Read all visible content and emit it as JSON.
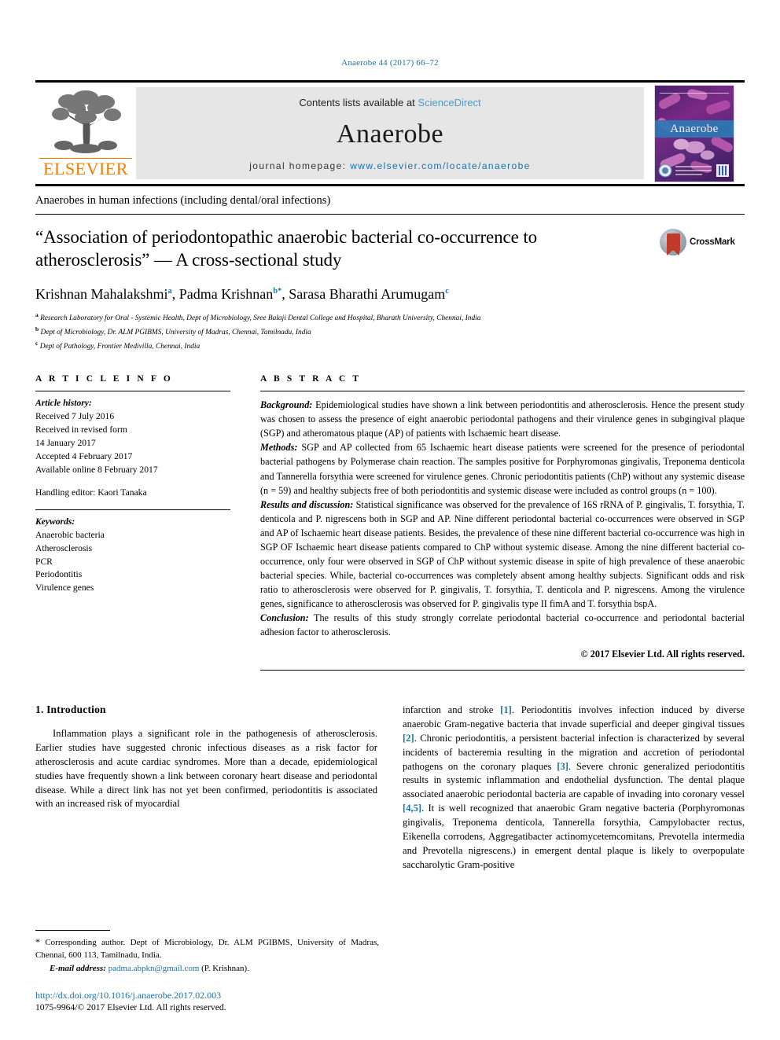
{
  "running_head": "Anaerobe 44 (2017) 66–72",
  "masthead": {
    "publisher_logo_label": "ELSEVIER",
    "contents_prefix": "Contents lists available at ",
    "contents_link": "ScienceDirect",
    "journal_name": "Anaerobe",
    "homepage_prefix": "journal homepage: ",
    "homepage_url": "www.elsevier.com/locate/anaerobe",
    "cover_title": "Anaerobe"
  },
  "section_banner": "Anaerobes in human infections (including dental/oral infections)",
  "article": {
    "title": "“Association of periodontopathic anaerobic bacterial co-occurrence to atherosclerosis” — A cross-sectional study",
    "crossmark_label": "CrossMark",
    "authors": [
      {
        "name": "Krishnan Mahalakshmi",
        "sup": "a",
        "star": false
      },
      {
        "name": "Padma Krishnan",
        "sup": "b",
        "star": true
      },
      {
        "name": "Sarasa Bharathi Arumugam",
        "sup": "c",
        "star": false
      }
    ],
    "affiliations": [
      {
        "marker": "a",
        "text": "Research Laboratory for Oral - Systemic Health, Dept of Microbiology, Sree Balaji Dental College and Hospital, Bharath University, Chennai, India"
      },
      {
        "marker": "b",
        "text": "Dept of Microbiology, Dr. ALM PGIBMS, University of Madras, Chennai, Tamilnadu, India"
      },
      {
        "marker": "c",
        "text": "Dept of Pathology, Frontier Medivilla, Chennai, India"
      }
    ]
  },
  "article_info": {
    "heading": "A R T I C L E   I N F O",
    "history_label": "Article history:",
    "history_lines": [
      "Received 7 July 2016",
      "Received in revised form",
      "14 January 2017",
      "Accepted 4 February 2017",
      "Available online 8 February 2017"
    ],
    "handling_editor": "Handling editor: Kaori Tanaka",
    "keywords_label": "Keywords:",
    "keywords": [
      "Anaerobic bacteria",
      "Atherosclerosis",
      "PCR",
      "Periodontitis",
      "Virulence genes"
    ]
  },
  "abstract": {
    "heading": "A B S T R A C T",
    "sections": [
      {
        "label": "Background:",
        "text": " Epidemiological studies have shown a link between periodontitis and atherosclerosis. Hence the present study was chosen to assess the presence of eight anaerobic periodontal pathogens and their virulence genes in subgingival plaque (SGP) and atheromatous plaque (AP) of patients with Ischaemic heart disease."
      },
      {
        "label": "Methods:",
        "text": " SGP and AP collected from 65 Ischaemic heart disease patients were screened for the presence of periodontal bacterial pathogens by Polymerase chain reaction. The samples positive for Porphyromonas gingivalis, Treponema denticola and Tannerella forsythia were screened for virulence genes. Chronic periodontitis patients (ChP) without any systemic disease (n = 59) and healthy subjects free of both periodontitis and systemic disease were included as control groups (n = 100)."
      },
      {
        "label": "Results and discussion:",
        "text": " Statistical significance was observed for the prevalence of 16S rRNA of P. gingivalis, T. forsythia, T. denticola and P. nigrescens both in SGP and AP. Nine different periodontal bacterial co-occurrences were observed in SGP and AP of Ischaemic heart disease patients. Besides, the prevalence of these nine different bacterial co-occurrence was high in SGP OF Ischaemic heart disease patients compared to ChP without systemic disease. Among the nine different bacterial co-occurrence, only four were observed in SGP of ChP without systemic disease in spite of high prevalence of these anaerobic bacterial species. While, bacterial co-occurrences was completely absent among healthy subjects. Significant odds and risk ratio to atherosclerosis were observed for P. gingivalis, T. forsythia, T. denticola and P. nigrescens. Among the virulence genes, significance to atherosclerosis was observed for P. gingivalis type II fimA and T. forsythia bspA."
      },
      {
        "label": "Conclusion:",
        "text": " The results of this study strongly correlate periodontal bacterial co-occurrence and periodontal bacterial adhesion factor to atherosclerosis."
      }
    ],
    "copyright": "© 2017 Elsevier Ltd. All rights reserved."
  },
  "introduction": {
    "heading": "1. Introduction",
    "left_paragraph": "Inflammation plays a significant role in the pathogenesis of atherosclerosis. Earlier studies have suggested chronic infectious diseases as a risk factor for atherosclerosis and acute cardiac syndromes. More than a decade, epidemiological studies have frequently shown a link between coronary heart disease and periodontal disease. While a direct link has not yet been confirmed, periodontitis is associated with an increased risk of myocardial",
    "right_paragraph_start": "infarction and stroke ",
    "right_refs": [
      "[1]",
      "[2]",
      "[3]",
      "[4,5]"
    ],
    "right_segments": [
      ". Periodontitis involves infection induced by diverse anaerobic Gram-negative bacteria that invade superficial and deeper gingival tissues ",
      ". Chronic periodontitis, a persistent bacterial infection is characterized by several incidents of bacteremia resulting in the migration and accretion of periodontal pathogens on the coronary plaques ",
      ". Severe chronic generalized periodontitis results in systemic inflammation and endothelial dysfunction. The dental plaque associated anaerobic periodontal bacteria are capable of invading into coronary vessel ",
      ". It is well recognized that anaerobic Gram negative bacteria (Porphyromonas gingivalis, Treponema denticola, Tannerella forsythia, Campylobacter rectus, Eikenella corrodens, Aggregatibacter actinomycetemcomitans, Prevotella intermedia and Prevotella nigrescens.) in emergent dental plaque is likely to overpopulate saccharolytic Gram-positive"
    ]
  },
  "footnote": {
    "star": "*",
    "corresponding": " Corresponding author. Dept of Microbiology, Dr. ALM PGIBMS, University of Madras, Chennai, 600 113, Tamilnadu, India.",
    "email_label": "E-mail address:",
    "email": "padma.abpkn@gmail.com",
    "email_owner": "(P. Krishnan).",
    "doi": "http://dx.doi.org/10.1016/j.anaerobe.2017.02.003",
    "issn": "1075-9964/© 2017 Elsevier Ltd. All rights reserved."
  },
  "colors": {
    "link": "#1a72a8",
    "elsevier_orange": "#ef7d00",
    "masthead_grey": "#e6e6e6",
    "crossmark_red": "#c0392b"
  }
}
